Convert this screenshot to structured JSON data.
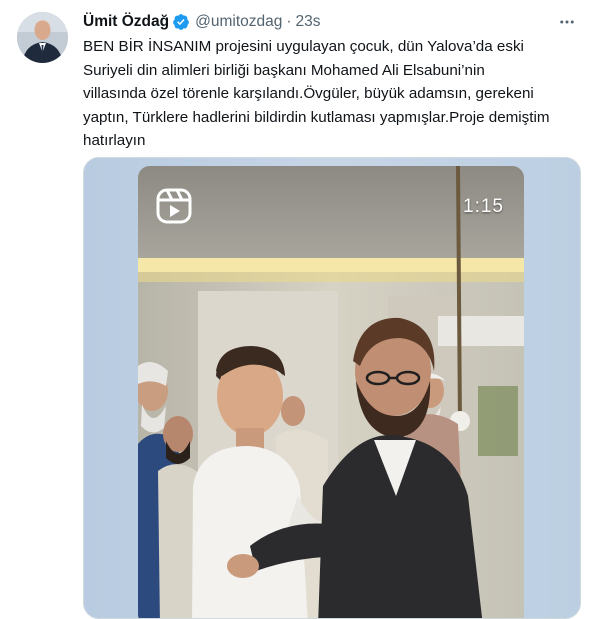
{
  "tweet": {
    "author_name": "Ümit Özdağ",
    "handle": "@umitozdag",
    "separator": "·",
    "time": "23s",
    "text": "BEN BİR İNSANIM projesini uygulayan çocuk, dün Yalova’da eski Suriyeli din alimleri birliği başkanı Mohamed Ali Elsabuni’nin villasında özel törenle karşılandı.Övgüler, büyük adamsın, gerekeni yaptın, Türklere hadlerini bildirdin kutlaması yapmışlar.Proje demiştim hatırlayın",
    "more_label": "···"
  },
  "media": {
    "duration": "1:15",
    "reels_icon": "reels-icon"
  },
  "colors": {
    "verified": "#1d9bf0",
    "secondary_text": "#536471",
    "media_border": "#cfd9de"
  }
}
